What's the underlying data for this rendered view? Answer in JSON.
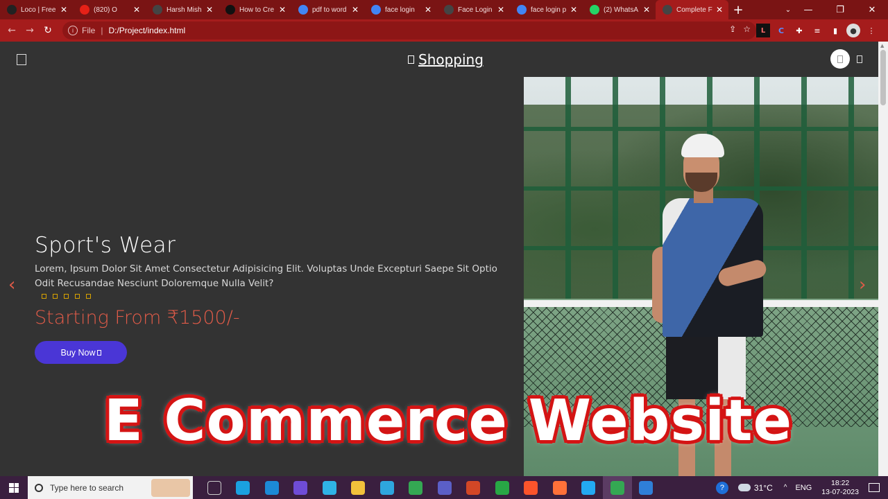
{
  "browser": {
    "tabs": [
      {
        "title": "Loco | Free",
        "color": "#222222"
      },
      {
        "title": "(820) O",
        "color": "#e62117"
      },
      {
        "title": "Harsh Mish",
        "color": "#444444"
      },
      {
        "title": "How to Cre",
        "color": "#111111"
      },
      {
        "title": "pdf to word",
        "color": "#4285f4"
      },
      {
        "title": "face login",
        "color": "#4285f4"
      },
      {
        "title": "Face Login",
        "color": "#444444"
      },
      {
        "title": "face login p",
        "color": "#4285f4"
      },
      {
        "title": "(2) WhatsA",
        "color": "#25d366"
      },
      {
        "title": "Complete F",
        "color": "#444444"
      }
    ],
    "close_glyph": "✕",
    "new_tab": "+",
    "controls": {
      "search_tabs": "⌄",
      "minimize": "—",
      "maximize": "❐",
      "close": "✕"
    },
    "nav": {
      "back": "←",
      "forward": "→",
      "reload": "↻"
    },
    "address": {
      "scheme": "File",
      "separator": "|",
      "url": "D:/Project/index.html"
    },
    "omni_icons": {
      "share": "⇪",
      "star": "☆"
    },
    "extensions": [
      {
        "name": "l-extension-icon",
        "glyph": "L"
      },
      {
        "name": "c-extension-icon",
        "glyph": "C"
      },
      {
        "name": "puzzle-icon",
        "glyph": "✚"
      },
      {
        "name": "media-icon",
        "glyph": "≡"
      },
      {
        "name": "sidepanel-icon",
        "glyph": "▮"
      },
      {
        "name": "profile-avatar",
        "glyph": "●"
      },
      {
        "name": "more-icon",
        "glyph": "⋮"
      }
    ]
  },
  "site": {
    "logo_text": "Shopping",
    "hero": {
      "title": "Sport's Wear",
      "description": "Lorem, Ipsum Dolor Sit Amet Consectetur Adipisicing Elit. Voluptas Unde Excepturi Saepe Sit Optio Odit Recusandae Nesciunt Doloremque Nulla Velit?",
      "rating": 5,
      "price": "Starting From ₹1500/-",
      "button": "Buy Now"
    },
    "arrows": {
      "prev": "‹",
      "next": "›"
    }
  },
  "overlay_title": "E Commerce Website",
  "taskbar": {
    "search_placeholder": "Type here to search",
    "apps": [
      {
        "name": "task-view-icon",
        "color": "#cccccc"
      },
      {
        "name": "edge-icon",
        "color": "#1aa1e0"
      },
      {
        "name": "mdp-icon",
        "color": "#1c8ad6"
      },
      {
        "name": "power-automate-icon",
        "color": "#6f4cd6"
      },
      {
        "name": "cortana-icon",
        "color": "#2fb3e6"
      },
      {
        "name": "file-explorer-icon",
        "color": "#f2c13b"
      },
      {
        "name": "telegram-icon",
        "color": "#2ea6de"
      },
      {
        "name": "chrome-icon",
        "color": "#34a853"
      },
      {
        "name": "teams-icon",
        "color": "#5b5fc7"
      },
      {
        "name": "powerpoint-icon",
        "color": "#d24726"
      },
      {
        "name": "green-app-icon",
        "color": "#28a745"
      },
      {
        "name": "brave-icon",
        "color": "#fb542b"
      },
      {
        "name": "firefox-icon",
        "color": "#ff7139"
      },
      {
        "name": "vscode-icon",
        "color": "#23a9f2"
      },
      {
        "name": "chrome-active-icon",
        "color": "#34a853"
      },
      {
        "name": "photos-icon",
        "color": "#2f7fd8"
      }
    ],
    "weather": "31°C",
    "chevron": "^",
    "language": "ENG",
    "time": "18:22",
    "date": "13-07-2023",
    "help_glyph": "?"
  }
}
